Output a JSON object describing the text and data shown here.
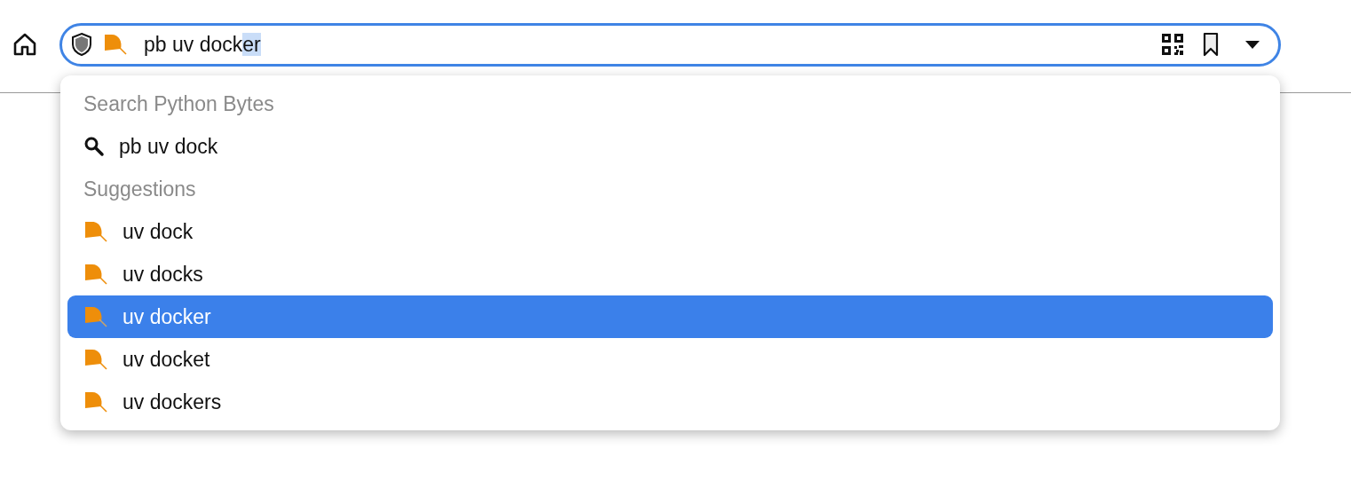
{
  "address_bar": {
    "typed": "pb uv dock",
    "autofill": "er"
  },
  "dropdown": {
    "search_heading": "Search Python Bytes",
    "search_item": {
      "label": "pb uv dock",
      "selected": false
    },
    "suggestions_heading": "Suggestions",
    "suggestions": [
      {
        "label": "uv dock",
        "selected": false
      },
      {
        "label": "uv docks",
        "selected": false
      },
      {
        "label": "uv docker",
        "selected": true
      },
      {
        "label": "uv docket",
        "selected": false
      },
      {
        "label": "uv dockers",
        "selected": false
      }
    ]
  }
}
